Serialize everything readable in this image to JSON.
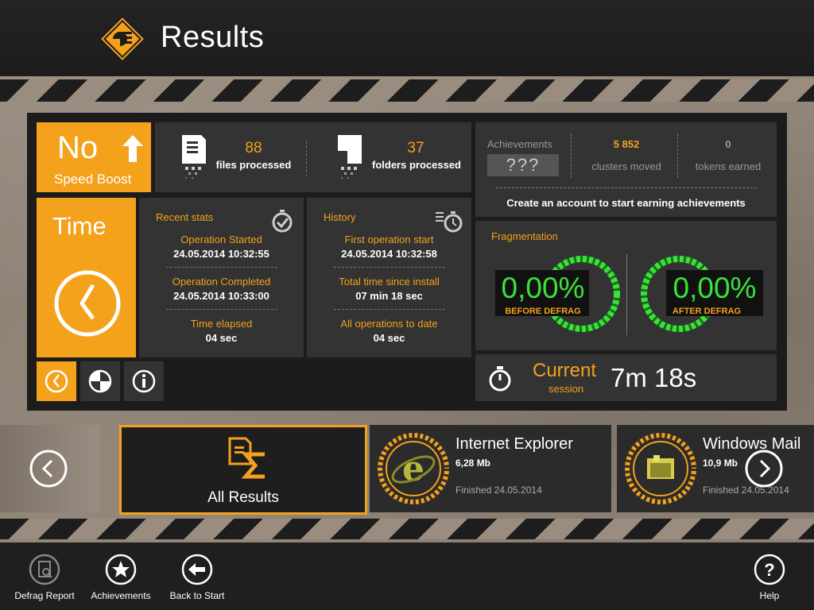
{
  "header": {
    "title": "Results"
  },
  "speed": {
    "value": "No",
    "label": "Speed Boost"
  },
  "processed": {
    "files_count": "88",
    "files_label": "files processed",
    "folders_count": "37",
    "folders_label": "folders processed"
  },
  "achievements": {
    "title": "Achievements",
    "value": "???",
    "clusters_count": "5 852",
    "clusters_label": "clusters moved",
    "tokens_count": "0",
    "tokens_label": "tokens earned",
    "message": "Create an account to start earning achievements"
  },
  "time_tile": {
    "label": "Time"
  },
  "recent_stats": {
    "title": "Recent stats",
    "rows": [
      {
        "label": "Operation Started",
        "value": "24.05.2014 10:32:55"
      },
      {
        "label": "Operation Completed",
        "value": "24.05.2014 10:33:00"
      },
      {
        "label": "Time elapsed",
        "value": "04 sec"
      }
    ]
  },
  "history": {
    "title": "History",
    "rows": [
      {
        "label": "First operation start",
        "value": "24.05.2014 10:32:58"
      },
      {
        "label": "Total time since install",
        "value": "07 min 18 sec"
      },
      {
        "label": "All operations to date",
        "value": "04 sec"
      }
    ]
  },
  "fragmentation": {
    "title": "Fragmentation",
    "before_value": "0,00%",
    "before_label": "BEFORE DEFRAG",
    "after_value": "0,00%",
    "after_label": "AFTER DEFRAG"
  },
  "current": {
    "label": "Current",
    "sub": "session",
    "time": "7m 18s"
  },
  "mini_tabs": [
    {
      "icon": "clock-icon",
      "active": true
    },
    {
      "icon": "pie-chart-icon",
      "active": false
    },
    {
      "icon": "info-icon",
      "active": false
    }
  ],
  "carousel": {
    "all_label": "All Results",
    "items": [
      {
        "name": "Internet Explorer",
        "size": "6,28 Mb",
        "finished": "Finished 24.05.2014"
      },
      {
        "name": "Windows Mail",
        "size": "10,9 Mb",
        "finished": "Finished 24.05.2014"
      }
    ]
  },
  "bottombar": {
    "defrag_report": "Defrag Report",
    "achievements": "Achievements",
    "back_to_start": "Back to Start",
    "help": "Help"
  },
  "colors": {
    "accent": "#f4a11c",
    "green": "#3be23b",
    "tile": "#333333",
    "panel": "#1c1c1c"
  }
}
